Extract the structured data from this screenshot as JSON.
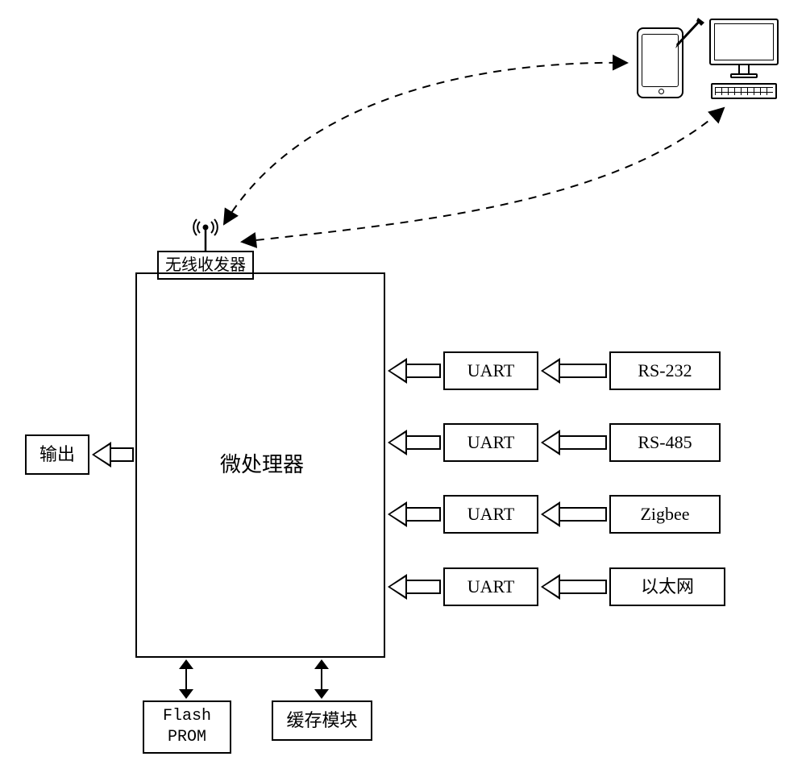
{
  "nodes": {
    "transceiver": "无线收发器",
    "microprocessor": "微处理器",
    "output": "输出",
    "uart": "UART",
    "protocols": {
      "rs232": "RS-232",
      "rs485": "RS-485",
      "zigbee": "Zigbee",
      "ethernet": "以太网"
    },
    "flash": "Flash\nPROM",
    "cache": "缓存模块"
  },
  "devices": {
    "tablet": "tablet",
    "computer": "computer"
  }
}
